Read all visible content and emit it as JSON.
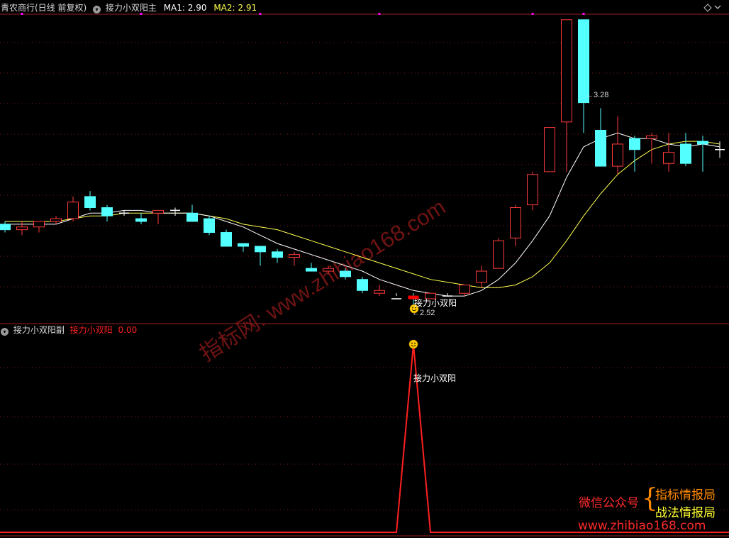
{
  "header": {
    "stock_label": "青农商行(日线 前复权)",
    "main_indicator": "接力小双阳主",
    "ma1_label": "MA1:",
    "ma1_value": "2.90",
    "ma2_label": "MA2:",
    "ma2_value": "2.91"
  },
  "sub_header": {
    "indicator": "接力小双阳副",
    "series_name": "接力小双阳",
    "series_value": "0.00"
  },
  "annotations": {
    "signal_text": "接力小双阳",
    "high_label": "3.28",
    "low_label": "2.52",
    "high_arrow": "←",
    "low_arrow": "←"
  },
  "branding": {
    "watermark": "指标网: www.zhibiao168.com",
    "wechat_label": "微信公众号",
    "account1": "指标情报局",
    "account2": "战法情报局",
    "website": "www.zhibiao168.com"
  },
  "colors": {
    "background": "#000000",
    "up_candle": "#ff3b3b",
    "down_candle": "#54ffff",
    "ma1": "#ffffff",
    "ma2": "#ffff4f",
    "signal_line": "#ff2020",
    "grid": "#7a1a1a",
    "magenta_marker": "#ff00ff"
  },
  "chart_data": [
    {
      "type": "candlestick",
      "title": "青农商行(日线 前复权)",
      "series": [
        {
          "name": "OHLC",
          "open": [
            2.81,
            2.79,
            2.8,
            2.82,
            2.83,
            2.91,
            2.87,
            2.85,
            2.83,
            2.85,
            2.86,
            2.85,
            2.83,
            2.78,
            2.74,
            2.73,
            2.71,
            2.69,
            2.65,
            2.64,
            2.64,
            2.61,
            2.56,
            2.54,
            2.55,
            2.54,
            2.55,
            2.56,
            2.6,
            2.65,
            2.76,
            2.88,
            3.0,
            3.18,
            3.55,
            3.15,
            3.02,
            3.12,
            3.12,
            3.03,
            3.1,
            3.11,
            3.08
          ],
          "high": [
            2.82,
            2.82,
            2.82,
            2.84,
            2.91,
            2.93,
            2.88,
            2.86,
            2.85,
            2.86,
            2.87,
            2.88,
            2.84,
            2.79,
            2.74,
            2.71,
            2.72,
            2.71,
            2.67,
            2.66,
            2.65,
            2.62,
            2.59,
            2.56,
            2.56,
            2.55,
            2.56,
            2.58,
            2.66,
            2.76,
            2.88,
            3.0,
            3.09,
            3.23,
            3.28,
            3.23,
            3.2,
            3.13,
            3.14,
            3.14,
            3.14,
            3.13,
            3.11
          ],
          "low": [
            2.78,
            2.77,
            2.78,
            2.81,
            2.82,
            2.86,
            2.82,
            2.84,
            2.81,
            2.81,
            2.84,
            2.83,
            2.77,
            2.74,
            2.71,
            2.66,
            2.67,
            2.66,
            2.65,
            2.63,
            2.61,
            2.56,
            2.55,
            2.55,
            2.52,
            2.54,
            2.55,
            2.55,
            2.58,
            2.65,
            2.73,
            2.86,
            3.0,
            3.0,
            3.14,
            3.03,
            2.99,
            3.0,
            3.03,
            3.0,
            3.02,
            3.0,
            3.05
          ],
          "close": [
            2.79,
            2.8,
            2.82,
            2.83,
            2.89,
            2.87,
            2.84,
            2.85,
            2.82,
            2.86,
            2.86,
            2.82,
            2.78,
            2.73,
            2.73,
            2.71,
            2.69,
            2.7,
            2.64,
            2.65,
            2.62,
            2.57,
            2.57,
            2.54,
            2.54,
            2.56,
            2.55,
            2.59,
            2.64,
            2.75,
            2.87,
            2.99,
            3.16,
            3.55,
            3.25,
            3.02,
            3.1,
            3.08,
            3.13,
            3.07,
            3.03,
            3.1,
            3.08
          ]
        },
        {
          "name": "MA1",
          "values": [
            2.81,
            2.81,
            2.81,
            2.81,
            2.83,
            2.85,
            2.85,
            2.86,
            2.86,
            2.85,
            2.85,
            2.85,
            2.84,
            2.82,
            2.8,
            2.77,
            2.74,
            2.72,
            2.7,
            2.68,
            2.66,
            2.64,
            2.61,
            2.59,
            2.57,
            2.56,
            2.55,
            2.55,
            2.57,
            2.61,
            2.67,
            2.75,
            2.84,
            2.98,
            3.09,
            3.12,
            3.14,
            3.12,
            3.12,
            3.1,
            3.09,
            3.1,
            3.09
          ]
        },
        {
          "name": "MA2",
          "values": [
            2.82,
            2.82,
            2.82,
            2.82,
            2.83,
            2.84,
            2.84,
            2.85,
            2.85,
            2.85,
            2.85,
            2.85,
            2.84,
            2.83,
            2.81,
            2.8,
            2.79,
            2.77,
            2.75,
            2.73,
            2.71,
            2.69,
            2.67,
            2.65,
            2.63,
            2.61,
            2.6,
            2.59,
            2.58,
            2.58,
            2.59,
            2.62,
            2.67,
            2.75,
            2.84,
            2.92,
            2.99,
            3.04,
            3.08,
            3.1,
            3.11,
            3.11,
            3.1
          ]
        }
      ],
      "ylim": [
        2.45,
        3.57
      ],
      "grid": true
    },
    {
      "type": "line",
      "title": "接力小双阳副",
      "series": [
        {
          "name": "接力小双阳",
          "values": [
            0,
            0,
            0,
            0,
            0,
            0,
            0,
            0,
            0,
            0,
            0,
            0,
            0,
            0,
            0,
            0,
            0,
            0,
            0,
            0,
            0,
            0,
            0,
            0,
            1,
            0,
            0,
            0,
            0,
            0,
            0,
            0,
            0,
            0,
            0,
            0,
            0,
            0,
            0,
            0,
            0,
            0,
            0
          ]
        }
      ],
      "ylim": [
        0,
        1
      ],
      "grid": true
    }
  ]
}
